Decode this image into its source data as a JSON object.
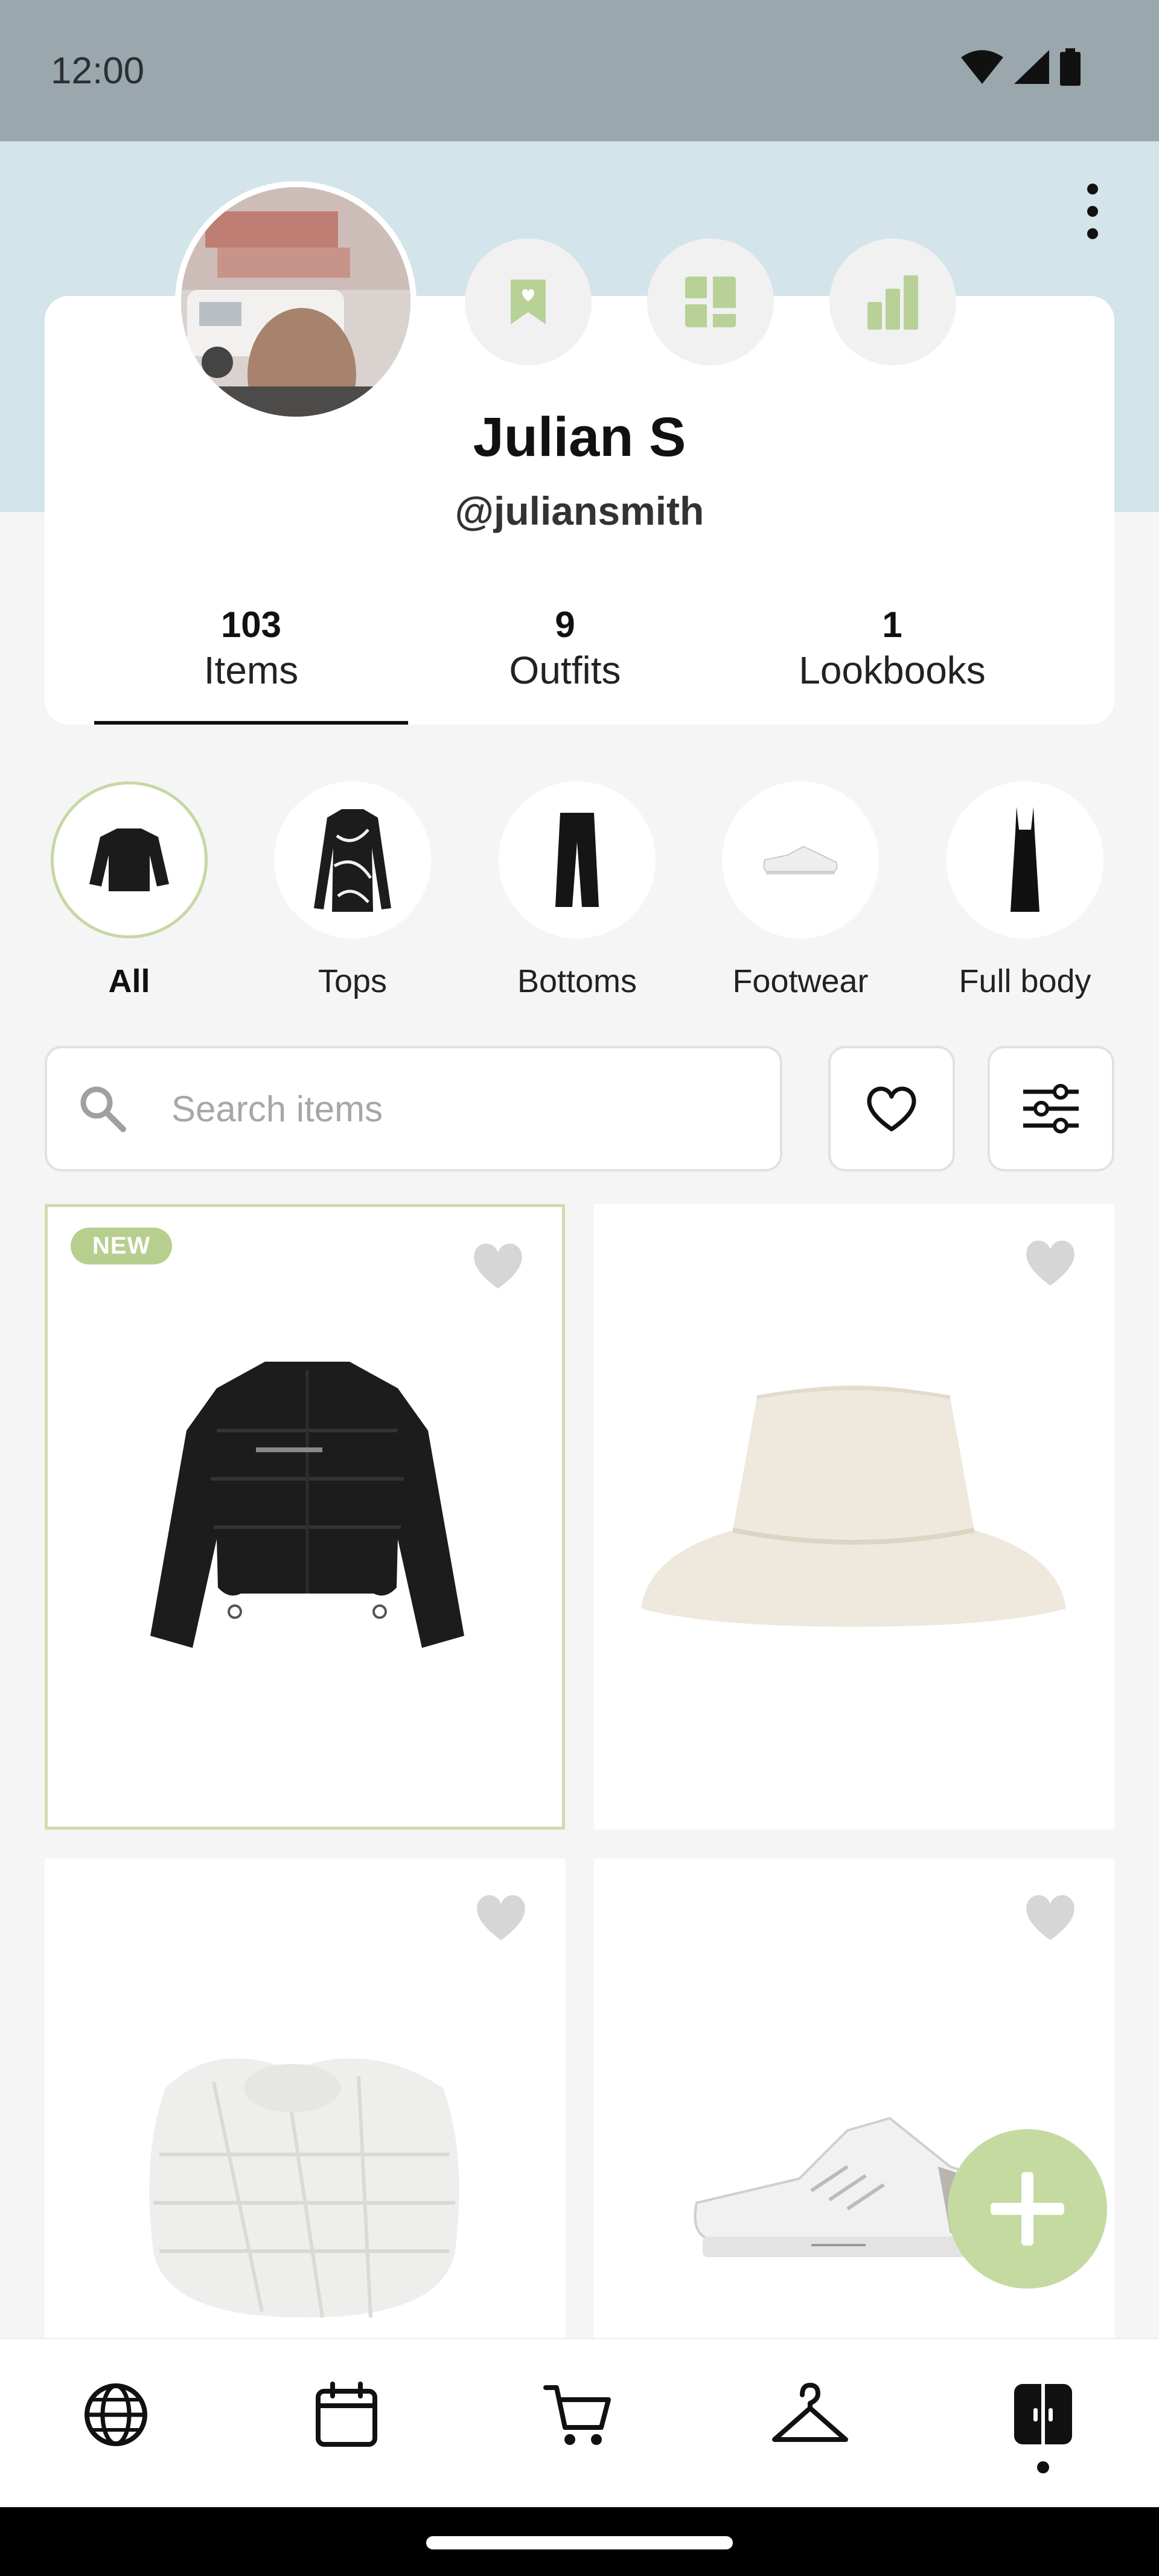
{
  "status_bar": {
    "time": "12:00"
  },
  "profile": {
    "name": "Julian S",
    "handle": "@juliansmith"
  },
  "stats": [
    {
      "count": "103",
      "label": "Items",
      "selected": true
    },
    {
      "count": "9",
      "label": "Outfits",
      "selected": false
    },
    {
      "count": "1",
      "label": "Lookbooks",
      "selected": false
    }
  ],
  "categories": [
    {
      "label": "All",
      "selected": true,
      "icon": "puffer-jacket"
    },
    {
      "label": "Tops",
      "selected": false,
      "icon": "patterned-top"
    },
    {
      "label": "Bottoms",
      "selected": false,
      "icon": "flared-pants"
    },
    {
      "label": "Footwear",
      "selected": false,
      "icon": "sneaker"
    },
    {
      "label": "Full body",
      "selected": false,
      "icon": "slip-dress"
    }
  ],
  "search": {
    "placeholder": "Search items"
  },
  "items": [
    {
      "name": "Black puffer jacket",
      "badge": "NEW",
      "favorited": false
    },
    {
      "name": "Cream bucket hat",
      "favorited": false
    },
    {
      "name": "White woven knot bag",
      "favorited": false
    },
    {
      "name": "White sneaker",
      "favorited": false
    }
  ],
  "bottom_nav": [
    {
      "icon": "globe-icon"
    },
    {
      "icon": "calendar-icon"
    },
    {
      "icon": "cart-icon"
    },
    {
      "icon": "hanger-icon"
    },
    {
      "icon": "wardrobe-icon",
      "active": true
    }
  ],
  "colors": {
    "header_band": "#d3e4ea",
    "accent_green": "#c5daa0",
    "badge_green": "#b7cf8e",
    "round_icon_green": "#b7d196"
  }
}
